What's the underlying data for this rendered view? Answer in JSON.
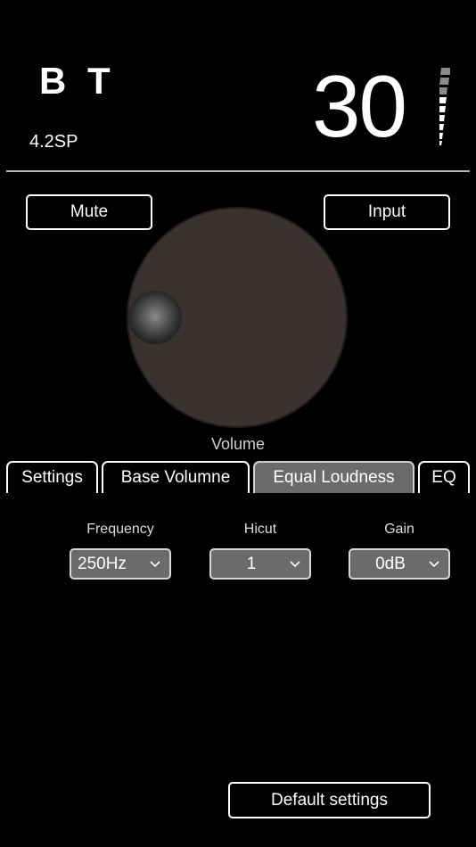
{
  "header": {
    "source": "B T",
    "model": "4.2SP",
    "volume_value": "30",
    "level_meter_icon": "volume-level-meter-icon"
  },
  "controls": {
    "mute_label": "Mute",
    "input_label": "Input",
    "volume_label": "Volume",
    "knob_indicator_icon": "knob-indicator-dot"
  },
  "tabs": [
    {
      "label": "Settings",
      "active": false
    },
    {
      "label": "Base Volumne",
      "active": false
    },
    {
      "label": "Equal Loudness",
      "active": true
    },
    {
      "label": "EQ",
      "active": false
    }
  ],
  "loudness": {
    "frequency": {
      "label": "Frequency",
      "value": "250Hz"
    },
    "hicut": {
      "label": "Hicut",
      "value": "1"
    },
    "gain": {
      "label": "Gain",
      "value": "0dB"
    }
  },
  "footer": {
    "default_settings_label": "Default settings"
  },
  "colors": {
    "background": "#000000",
    "knob": "#3a3230",
    "active_tab": "#6b6b6b",
    "select_bg": "#6b6b6b"
  }
}
